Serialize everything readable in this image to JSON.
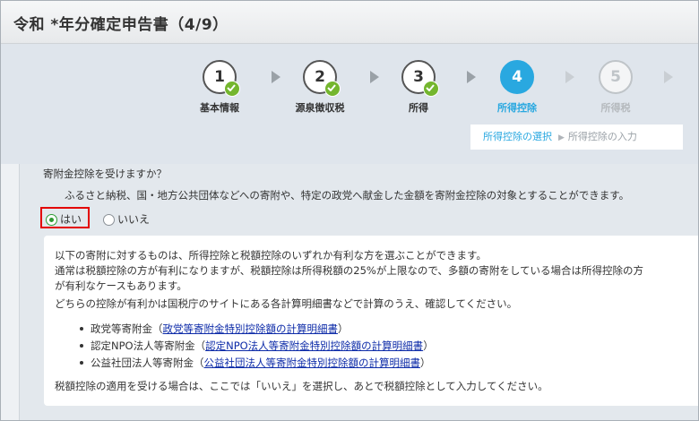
{
  "window": {
    "title": "令和 *年分確定申告書（4/9）"
  },
  "stepper": {
    "steps": [
      {
        "number": "1",
        "label": "基本情報",
        "state": "done"
      },
      {
        "number": "2",
        "label": "源泉徴収税",
        "state": "done"
      },
      {
        "number": "3",
        "label": "所得",
        "state": "done"
      },
      {
        "number": "4",
        "label": "所得控除",
        "state": "current"
      },
      {
        "number": "5",
        "label": "所得税",
        "state": "todo"
      }
    ],
    "substeps": {
      "current": "所得控除の選択",
      "separator": "▶",
      "next": "所得控除の入力"
    }
  },
  "form": {
    "question": "寄附金控除を受けますか？",
    "description": "ふるさと納税、国・地方公共団体などへの寄附や、特定の政党へ献金した金額を寄附金控除の対象とすることができます。",
    "options": {
      "yes": "はい",
      "no": "いいえ",
      "selected": "yes"
    }
  },
  "info": {
    "line1": "以下の寄附に対するものは、所得控除と税額控除のいずれか有利な方を選ぶことができます。",
    "line2": "通常は税額控除の方が有利になりますが、税額控除は所得税額の25%が上限なので、多額の寄附をしている場合は所得控除の方",
    "line3": "が有利なケースもあります。",
    "line4": "どちらの控除が有利かは国税庁のサイトにある各計算明細書などで計算のうえ、確認してください。",
    "items": [
      {
        "prefix": "政党等寄附金（",
        "link": "政党等寄附金特別控除額の計算明細書",
        "suffix": "）"
      },
      {
        "prefix": "認定NPO法人等寄附金（",
        "link": "認定NPO法人等寄附金特別控除額の計算明細書",
        "suffix": "）"
      },
      {
        "prefix": "公益社団法人等寄附金（",
        "link": "公益社団法人等寄附金特別控除額の計算明細書",
        "suffix": "）"
      }
    ],
    "footer": "税額控除の適用を受ける場合は、ここでは「いいえ」を選択し、あとで税額控除として入力してください。"
  },
  "colors": {
    "accent": "#29a8e0",
    "done_check": "#74b62e",
    "highlight_border": "#e30000",
    "link": "#0d2ba8"
  }
}
